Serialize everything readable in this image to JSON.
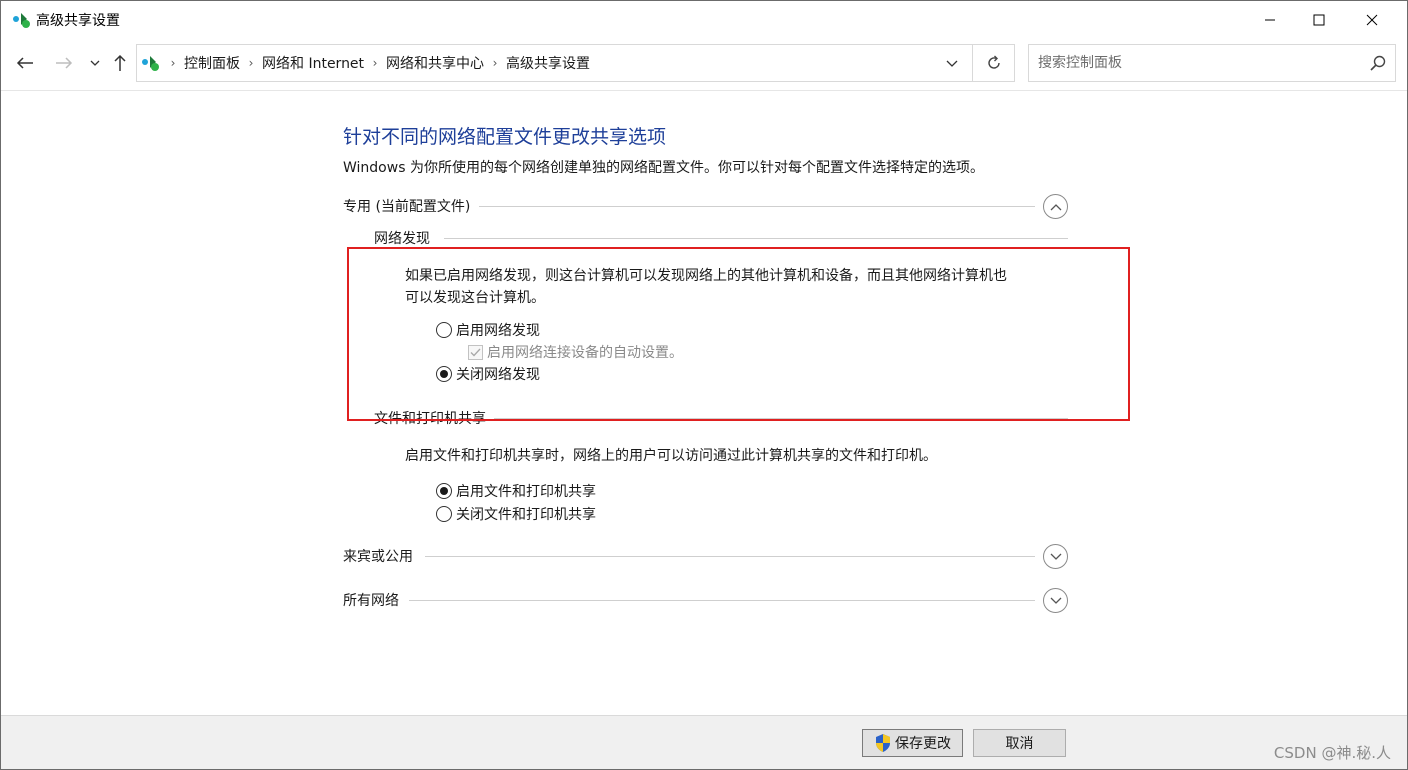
{
  "window": {
    "title": "高级共享设置",
    "minimize_label": "—",
    "maximize_label": "☐",
    "close_label": "✕"
  },
  "nav": {
    "back_icon": "arrow-left-icon",
    "forward_icon": "arrow-right-icon",
    "recent_icon": "chevron-down-icon",
    "up_icon": "arrow-up-icon",
    "breadcrumbs": [
      "控制面板",
      "网络和 Internet",
      "网络和共享中心",
      "高级共享设置"
    ],
    "refresh_icon": "refresh-icon"
  },
  "search": {
    "placeholder": "搜索控制面板"
  },
  "content": {
    "heading": "针对不同的网络配置文件更改共享选项",
    "description": "Windows 为你所使用的每个网络创建单独的网络配置文件。你可以针对每个配置文件选择特定的选项。",
    "profiles": {
      "private": {
        "label": "专用 (当前配置文件)",
        "expanded": true,
        "network_discovery": {
          "label": "网络发现",
          "description_line1": "如果已启用网络发现，则这台计算机可以发现网络上的其他计算机和设备，而且其他网络计算机也",
          "description_line2": "可以发现这台计算机。",
          "option_on": "启用网络发现",
          "option_auto": "启用网络连接设备的自动设置。",
          "option_off": "关闭网络发现",
          "selected": "off",
          "auto_checked": true,
          "auto_disabled": true
        },
        "file_printer_sharing": {
          "label": "文件和打印机共享",
          "description": "启用文件和打印机共享时，网络上的用户可以访问通过此计算机共享的文件和打印机。",
          "option_on": "启用文件和打印机共享",
          "option_off": "关闭文件和打印机共享",
          "selected": "on"
        }
      },
      "guest_public": {
        "label": "来宾或公用",
        "expanded": false
      },
      "all_networks": {
        "label": "所有网络",
        "expanded": false
      }
    }
  },
  "footer": {
    "save_label": "保存更改",
    "cancel_label": "取消",
    "watermark": "CSDN @神.秘.人"
  },
  "colors": {
    "heading": "#1e3f99",
    "highlight_box": "#e02020",
    "footer_bg": "#f0f0f0"
  }
}
